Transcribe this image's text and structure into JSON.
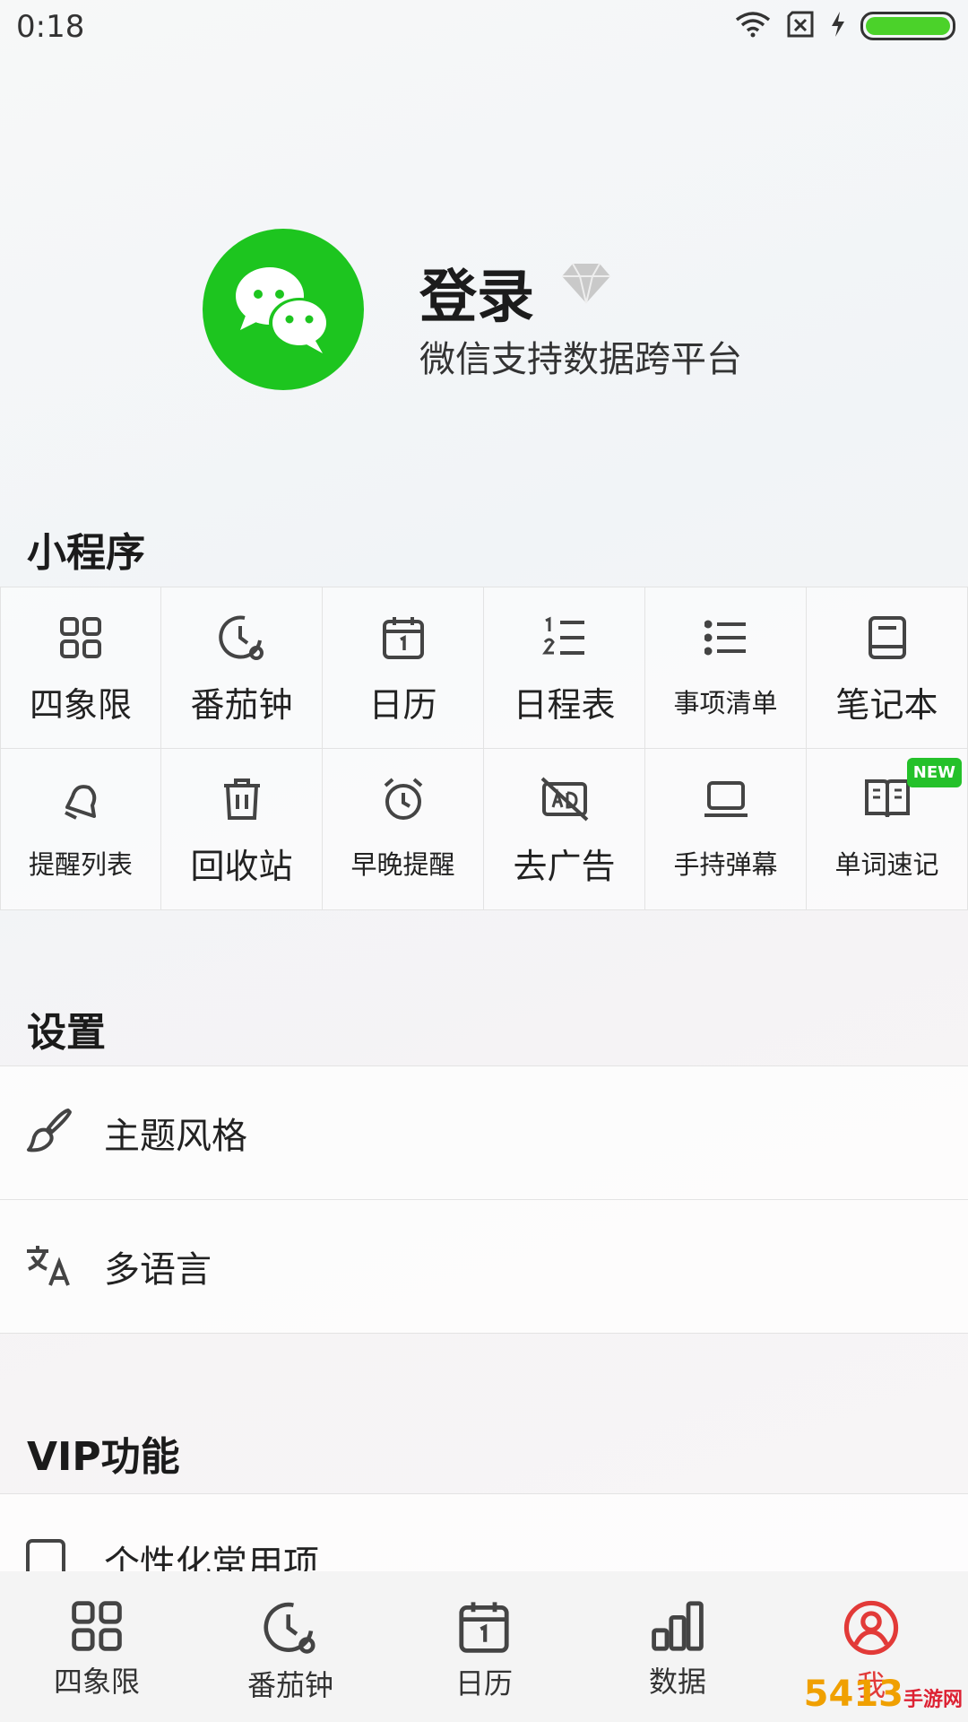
{
  "status_bar": {
    "time": "0:18"
  },
  "profile": {
    "title": "登录",
    "subtitle": "微信支持数据跨平台"
  },
  "mini_programs": {
    "title": "小程序",
    "items": [
      {
        "label": "四象限",
        "icon": "grid-four-icon"
      },
      {
        "label": "番茄钟",
        "icon": "clock-icon"
      },
      {
        "label": "日历",
        "icon": "calendar-icon"
      },
      {
        "label": "日程表",
        "icon": "numbered-list-icon"
      },
      {
        "label": "事项清单",
        "icon": "list-icon"
      },
      {
        "label": "笔记本",
        "icon": "notebook-icon"
      },
      {
        "label": "提醒列表",
        "icon": "bell-icon"
      },
      {
        "label": "回收站",
        "icon": "trash-icon"
      },
      {
        "label": "早晚提醒",
        "icon": "alarm-icon"
      },
      {
        "label": "去广告",
        "icon": "no-ad-icon"
      },
      {
        "label": "手持弹幕",
        "icon": "laptop-icon"
      },
      {
        "label": "单词速记",
        "icon": "book-open-icon",
        "badge": "NEW"
      }
    ]
  },
  "settings": {
    "title": "设置",
    "items": [
      {
        "label": "主题风格",
        "icon": "brush-icon"
      },
      {
        "label": "多语言",
        "icon": "translate-icon"
      }
    ]
  },
  "vip": {
    "title": "VIP功能",
    "items": [
      {
        "label": "个性化常用项",
        "icon": "checkbox-icon"
      }
    ]
  },
  "tabbar": {
    "items": [
      {
        "label": "四象限",
        "icon": "grid-four-icon"
      },
      {
        "label": "番茄钟",
        "icon": "clock-icon"
      },
      {
        "label": "日历",
        "icon": "calendar-icon"
      },
      {
        "label": "数据",
        "icon": "bar-chart-icon"
      },
      {
        "label": "我",
        "icon": "user-icon",
        "active": true
      }
    ]
  },
  "colors": {
    "accent_green": "#1dc51f",
    "badge_green": "#24c12a",
    "active_tab": "#e23a38"
  },
  "watermark": {
    "text": "5413",
    "sub": "手游网"
  }
}
